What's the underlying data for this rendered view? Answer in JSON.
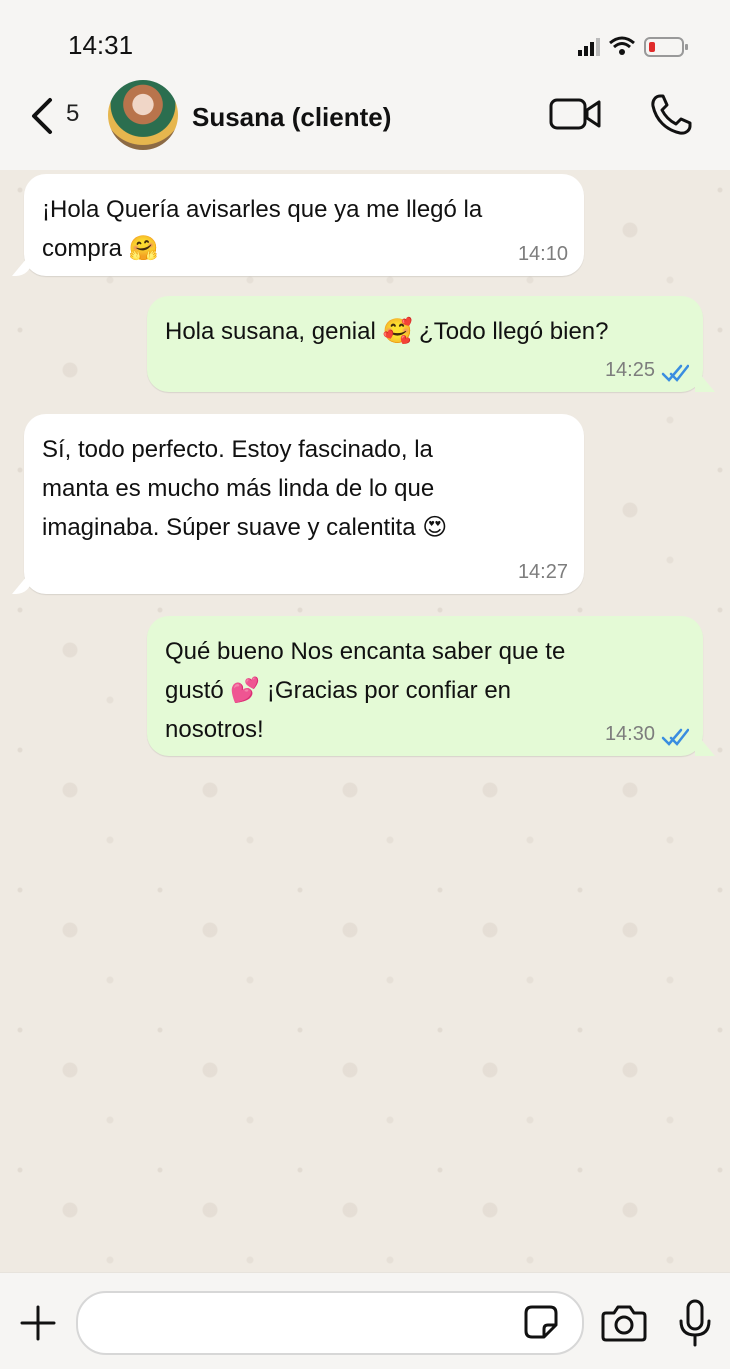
{
  "status_bar": {
    "time": "14:31"
  },
  "header": {
    "back_count": "5",
    "contact_name": "Susana (cliente)"
  },
  "messages": [
    {
      "direction": "in",
      "text": "¡Hola Quería avisarles que ya me llegó la\ncompra 🤗",
      "time": "14:10"
    },
    {
      "direction": "out",
      "text": "Hola susana, genial 🥰 ¿Todo llegó bien?",
      "time": "14:25",
      "status": "read"
    },
    {
      "direction": "in",
      "text": "Sí, todo perfecto. Estoy fascinado, la\nmanta es mucho más linda de lo que\nimaginaba. Súper suave y calentita 😍",
      "time": "14:27"
    },
    {
      "direction": "out",
      "text": "Qué bueno Nos encanta saber que te\ngustó 💕 ¡Gracias por confiar en\nnosotros!",
      "time": "14:30",
      "status": "read"
    }
  ],
  "composer": {
    "value": "",
    "placeholder": ""
  },
  "icons": {
    "back": "chevron-left-icon",
    "video": "video-camera-icon",
    "call": "phone-icon",
    "plus": "plus-icon",
    "sticker": "sticker-icon",
    "camera": "camera-icon",
    "mic": "microphone-icon",
    "read": "double-check-icon"
  },
  "colors": {
    "incoming_bubble": "#ffffff",
    "outgoing_bubble": "#e4fad6",
    "read_ticks": "#3a8de0",
    "battery_low": "#e02b2b"
  }
}
